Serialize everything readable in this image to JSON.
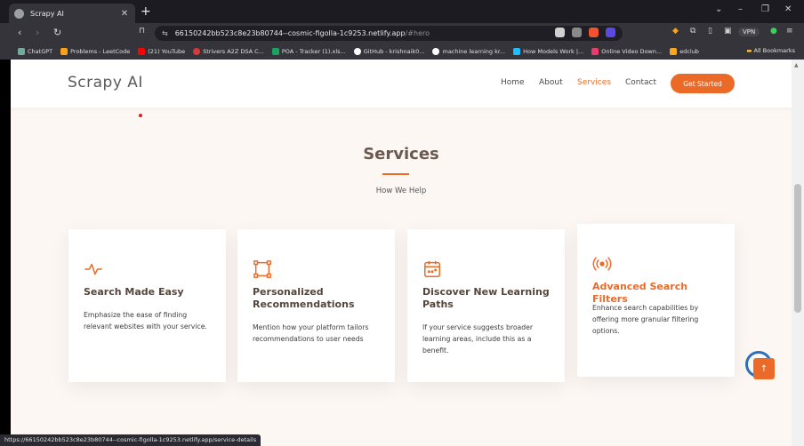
{
  "browser": {
    "tab_title": "Scrapy AI",
    "url_host": "66150242bb523c8e23b80744--cosmic-figolla-1c9253.netlify.app",
    "url_path": "/#hero",
    "vpn_label": "VPN",
    "status_url": "https://66150242bb523c8e23b80744--cosmic-figolla-1c9253.netlify.app/service-details",
    "bookmarks": [
      {
        "label": "ChatGPT",
        "color": "#74aa9c"
      },
      {
        "label": "Problems - LeetCode",
        "color": "#f8a21c"
      },
      {
        "label": "(21) YouTube",
        "color": "#ff0000"
      },
      {
        "label": "Strivers A2Z DSA C...",
        "color": "#d83a3a"
      },
      {
        "label": "POA - Tracker (1).xls...",
        "color": "#1aa260"
      },
      {
        "label": "GitHub - krishnaik0...",
        "color": "#ffffff"
      },
      {
        "label": "machine learning kr...",
        "color": "#ffffff"
      },
      {
        "label": "How Models Work |...",
        "color": "#20beff"
      },
      {
        "label": "Online Video Down...",
        "color": "#e83c6c"
      },
      {
        "label": "edclub",
        "color": "#f5a623"
      }
    ],
    "all_bookmarks": "All Bookmarks"
  },
  "site": {
    "logo": "Scrapy AI",
    "nav": [
      {
        "label": "Home",
        "active": false
      },
      {
        "label": "About",
        "active": false
      },
      {
        "label": "Services",
        "active": true
      },
      {
        "label": "Contact",
        "active": false
      }
    ],
    "cta": "Get Started"
  },
  "services": {
    "title": "Services",
    "subtitle": "How We Help",
    "accent_color": "#ec6a28",
    "cards": [
      {
        "icon": "activity-icon",
        "title": "Search Made Easy",
        "description": "Emphasize the ease of finding relevant websites with your service."
      },
      {
        "icon": "bounding-box-icon",
        "title": "Personalized Recommendations",
        "description": "Mention how your platform tailors recommendations to user needs"
      },
      {
        "icon": "calendar-icon",
        "title": "Discover New Learning Paths",
        "description": "If your service suggests broader learning areas, include this as a benefit."
      },
      {
        "icon": "broadcast-icon",
        "title": "Advanced Search Filters",
        "description": "Enhance search capabilities by offering more granular filtering options."
      }
    ]
  }
}
